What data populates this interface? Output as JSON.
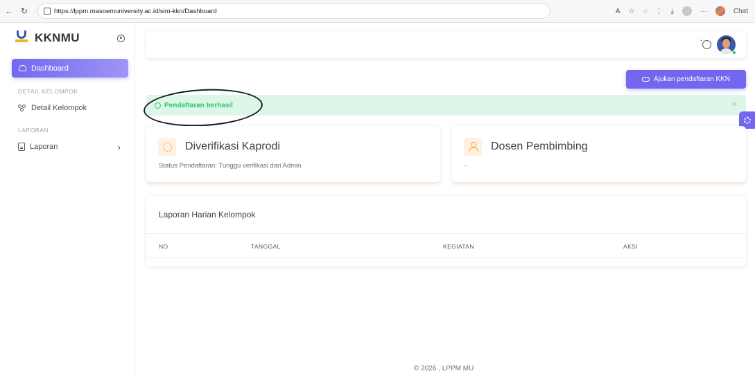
{
  "browser": {
    "url": "https://lppm.masoemuniversity.ac.id/sim-kkn/Dashboard",
    "chat_label": "Chat"
  },
  "sidebar": {
    "brand": "KKNMU",
    "active_item": "Dashboard",
    "sections": [
      {
        "header": "DETAIL KELOMPOK",
        "item": "Detail Kelompok"
      },
      {
        "header": "LAPORAN",
        "item": "Laporan"
      }
    ]
  },
  "main": {
    "cta_label": "Ajukan pendaftaran KKN",
    "alert_text": "Pendaftaran berhasil",
    "alert_close": "×",
    "cards": [
      {
        "title": "Diverifikasi Kaprodi",
        "subtitle": "Status Pendaftaran: Tunggu verifikasi dari Admin"
      },
      {
        "title": "Dosen Pembimbing",
        "subtitle": "-"
      }
    ],
    "table": {
      "title": "Laporan Harian Kelompok",
      "columns": [
        "NO",
        "TANGGAL",
        "KEGIATAN",
        "AKSI"
      ]
    },
    "footer": "© 2026 , LPPM MU"
  },
  "colors": {
    "primary": "#7367f0",
    "success": "#28c76f",
    "warning": "#ff9f43"
  },
  "icons": [
    "home-icon",
    "users-icon",
    "document-icon",
    "chevron-right-icon",
    "sun-icon",
    "upload-cloud-icon",
    "info-icon",
    "close-icon",
    "loader-icon",
    "user-icon",
    "gear-icon"
  ]
}
